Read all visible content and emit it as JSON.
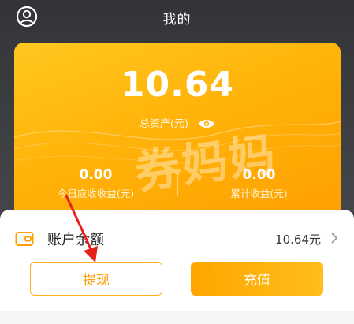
{
  "header": {
    "title": "我的"
  },
  "card": {
    "total_value": "10.64",
    "total_label": "总资产(元)",
    "stats": [
      {
        "value": "0.00",
        "label": "今日应收收益(元)"
      },
      {
        "value": "0.00",
        "label": "累计收益(元)"
      }
    ]
  },
  "balance": {
    "title": "账户余额",
    "value": "10.64元"
  },
  "buttons": {
    "withdraw": "提现",
    "recharge": "充值"
  },
  "watermark": "券妈妈",
  "icons": {
    "avatar": "user-circle-icon",
    "eye": "eye-icon",
    "wallet": "wallet-icon",
    "chevron": "chevron-right-icon"
  },
  "colors": {
    "accent": "#ffb30a",
    "button_text": "#ff9a00",
    "annotation_arrow": "#e8201a",
    "header_bg": "#3a3b3e"
  }
}
